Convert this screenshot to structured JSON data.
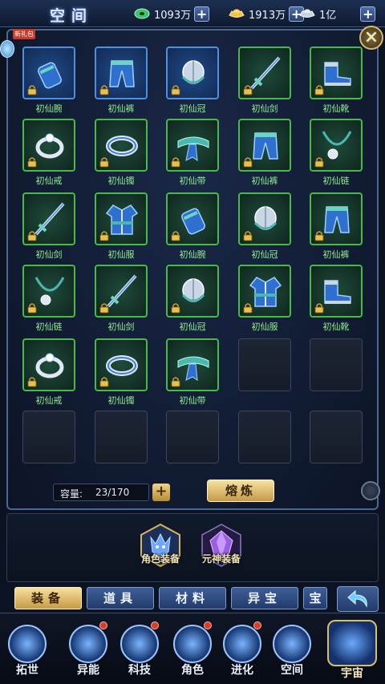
{
  "header": {
    "title": "空间",
    "resources": [
      {
        "icon": "jade-icon",
        "value": "1093万"
      },
      {
        "icon": "gold-ingot-icon",
        "value": "1913万"
      },
      {
        "icon": "silver-ingot-icon",
        "value": "1亿"
      }
    ],
    "new_gift_label": "新礼包"
  },
  "inventory": {
    "rows": [
      [
        {
          "name": "初仙腕",
          "rarity": "blue",
          "icon": "bracer-icon"
        },
        {
          "name": "初仙裤",
          "rarity": "blue",
          "icon": "pants-icon"
        },
        {
          "name": "初仙冠",
          "rarity": "blue",
          "icon": "helmet-icon"
        },
        {
          "name": "初仙剑",
          "rarity": "green",
          "icon": "sword-icon"
        },
        {
          "name": "初仙靴",
          "rarity": "green",
          "icon": "boots-icon"
        }
      ],
      [
        {
          "name": "初仙戒",
          "rarity": "green",
          "icon": "ring-icon"
        },
        {
          "name": "初仙镯",
          "rarity": "green",
          "icon": "bracelet-icon"
        },
        {
          "name": "初仙带",
          "rarity": "green",
          "icon": "belt-icon"
        },
        {
          "name": "初仙裤",
          "rarity": "green",
          "icon": "pants-icon"
        },
        {
          "name": "初仙链",
          "rarity": "green",
          "icon": "necklace-icon"
        }
      ],
      [
        {
          "name": "初仙剑",
          "rarity": "green",
          "icon": "sword-icon"
        },
        {
          "name": "初仙服",
          "rarity": "green",
          "icon": "robe-icon"
        },
        {
          "name": "初仙腕",
          "rarity": "green",
          "icon": "bracer-icon"
        },
        {
          "name": "初仙冠",
          "rarity": "green",
          "icon": "helmet-icon"
        },
        {
          "name": "初仙裤",
          "rarity": "green",
          "icon": "pants-icon"
        }
      ],
      [
        {
          "name": "初仙链",
          "rarity": "green",
          "icon": "necklace-icon"
        },
        {
          "name": "初仙剑",
          "rarity": "green",
          "icon": "sword-icon"
        },
        {
          "name": "初仙冠",
          "rarity": "green",
          "icon": "helmet-icon"
        },
        {
          "name": "初仙服",
          "rarity": "green",
          "icon": "robe-icon"
        },
        {
          "name": "初仙靴",
          "rarity": "green",
          "icon": "boots-icon"
        }
      ],
      [
        {
          "name": "初仙戒",
          "rarity": "green",
          "icon": "ring-icon"
        },
        {
          "name": "初仙镯",
          "rarity": "green",
          "icon": "bracelet-icon"
        },
        {
          "name": "初仙带",
          "rarity": "green",
          "icon": "belt-icon"
        },
        {
          "name": "",
          "rarity": "empty",
          "icon": ""
        },
        {
          "name": "",
          "rarity": "empty",
          "icon": ""
        }
      ],
      [
        {
          "name": "",
          "rarity": "empty",
          "icon": ""
        },
        {
          "name": "",
          "rarity": "empty",
          "icon": ""
        },
        {
          "name": "",
          "rarity": "empty",
          "icon": ""
        },
        {
          "name": "",
          "rarity": "empty",
          "icon": ""
        },
        {
          "name": "",
          "rarity": "empty",
          "icon": ""
        }
      ]
    ],
    "capacity_label": "容量:",
    "capacity_value": "23/170",
    "smelt_label": "熔炼"
  },
  "equip_sets": [
    {
      "label": "角色装备",
      "icon": "wolf-emblem-icon"
    },
    {
      "label": "元神装备",
      "icon": "purple-crystal-icon"
    }
  ],
  "tabs": [
    "装备",
    "道具",
    "材料",
    "异宝",
    "宝"
  ],
  "nav": [
    {
      "label": "拓世",
      "icon": "expedition-icon",
      "badge": false
    },
    {
      "label": "异能",
      "icon": "ability-icon",
      "badge": true
    },
    {
      "label": "科技",
      "icon": "tech-icon",
      "badge": true
    },
    {
      "label": "角色",
      "icon": "character-icon",
      "badge": true
    },
    {
      "label": "进化",
      "icon": "evolution-icon",
      "badge": true
    },
    {
      "label": "空间",
      "icon": "space-icon",
      "badge": false
    },
    {
      "label": "宇宙",
      "icon": "universe-icon",
      "badge": false
    }
  ]
}
